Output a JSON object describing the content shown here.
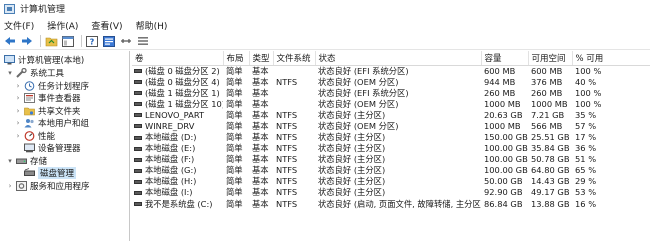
{
  "window": {
    "title": "计算机管理"
  },
  "menu": [
    "文件(F)",
    "操作(A)",
    "查看(V)",
    "帮助(H)"
  ],
  "toolbar": [
    {
      "name": "back-icon"
    },
    {
      "name": "forward-icon"
    },
    {
      "sep": true
    },
    {
      "name": "up-folder-icon"
    },
    {
      "name": "show-pane-icon"
    },
    {
      "sep": true
    },
    {
      "name": "help-icon"
    },
    {
      "name": "properties-icon"
    },
    {
      "name": "connect-icon"
    },
    {
      "name": "list-view-icon"
    }
  ],
  "tree": [
    {
      "label": "计算机管理(本地)",
      "level": 0,
      "arrow": "",
      "icon": "computer-icon"
    },
    {
      "label": "系统工具",
      "level": 1,
      "arrow": "▾",
      "icon": "tools-icon"
    },
    {
      "label": "任务计划程序",
      "level": 2,
      "arrow": "›",
      "icon": "task-scheduler-icon"
    },
    {
      "label": "事件查看器",
      "level": 2,
      "arrow": "›",
      "icon": "event-viewer-icon"
    },
    {
      "label": "共享文件夹",
      "level": 2,
      "arrow": "›",
      "icon": "shared-folder-icon"
    },
    {
      "label": "本地用户和组",
      "level": 2,
      "arrow": "›",
      "icon": "users-icon"
    },
    {
      "label": "性能",
      "level": 2,
      "arrow": "›",
      "icon": "performance-icon"
    },
    {
      "label": "设备管理器",
      "level": 2,
      "arrow": "",
      "icon": "device-manager-icon"
    },
    {
      "label": "存储",
      "level": 1,
      "arrow": "▾",
      "icon": "storage-icon"
    },
    {
      "label": "磁盘管理",
      "level": 2,
      "arrow": "",
      "icon": "disk-management-icon",
      "selected": true
    },
    {
      "label": "服务和应用程序",
      "level": 1,
      "arrow": "›",
      "icon": "services-icon"
    }
  ],
  "columns": [
    "卷",
    "布局",
    "类型",
    "文件系统",
    "状态",
    "容量",
    "可用空间",
    "% 可用"
  ],
  "rows": [
    [
      "(磁盘 0 磁盘分区 2)",
      "简单",
      "基本",
      "",
      "状态良好 (EFI 系统分区)",
      "600 MB",
      "600 MB",
      "100 %"
    ],
    [
      "(磁盘 0 磁盘分区 4)",
      "简单",
      "基本",
      "NTFS",
      "状态良好 (OEM 分区)",
      "944 MB",
      "376 MB",
      "40 %"
    ],
    [
      "(磁盘 1 磁盘分区 1)",
      "简单",
      "基本",
      "",
      "状态良好 (EFI 系统分区)",
      "260 MB",
      "260 MB",
      "100 %"
    ],
    [
      "(磁盘 1 磁盘分区 10)",
      "简单",
      "基本",
      "",
      "状态良好 (OEM 分区)",
      "1000 MB",
      "1000 MB",
      "100 %"
    ],
    [
      "LENOVO_PART",
      "简单",
      "基本",
      "NTFS",
      "状态良好 (主分区)",
      "20.63 GB",
      "7.21 GB",
      "35 %"
    ],
    [
      "WINRE_DRV",
      "简单",
      "基本",
      "NTFS",
      "状态良好 (OEM 分区)",
      "1000 MB",
      "566 MB",
      "57 %"
    ],
    [
      "本地磁盘 (D:)",
      "简单",
      "基本",
      "NTFS",
      "状态良好 (主分区)",
      "150.00 GB",
      "25.51 GB",
      "17 %"
    ],
    [
      "本地磁盘 (E:)",
      "简单",
      "基本",
      "NTFS",
      "状态良好 (主分区)",
      "100.00 GB",
      "35.84 GB",
      "36 %"
    ],
    [
      "本地磁盘 (F:)",
      "简单",
      "基本",
      "NTFS",
      "状态良好 (主分区)",
      "100.00 GB",
      "50.78 GB",
      "51 %"
    ],
    [
      "本地磁盘 (G:)",
      "简单",
      "基本",
      "NTFS",
      "状态良好 (主分区)",
      "100.00 GB",
      "64.80 GB",
      "65 %"
    ],
    [
      "本地磁盘 (H:)",
      "简单",
      "基本",
      "NTFS",
      "状态良好 (主分区)",
      "50.00 GB",
      "14.43 GB",
      "29 %"
    ],
    [
      "本地磁盘 (I:)",
      "简单",
      "基本",
      "NTFS",
      "状态良好 (主分区)",
      "92.90 GB",
      "49.17 GB",
      "53 %"
    ],
    [
      "我不是系统盘 (C:)",
      "简单",
      "基本",
      "NTFS",
      "状态良好 (启动, 页面文件, 故障转储, 主分区)",
      "86.84 GB",
      "13.88 GB",
      "16 %"
    ]
  ]
}
